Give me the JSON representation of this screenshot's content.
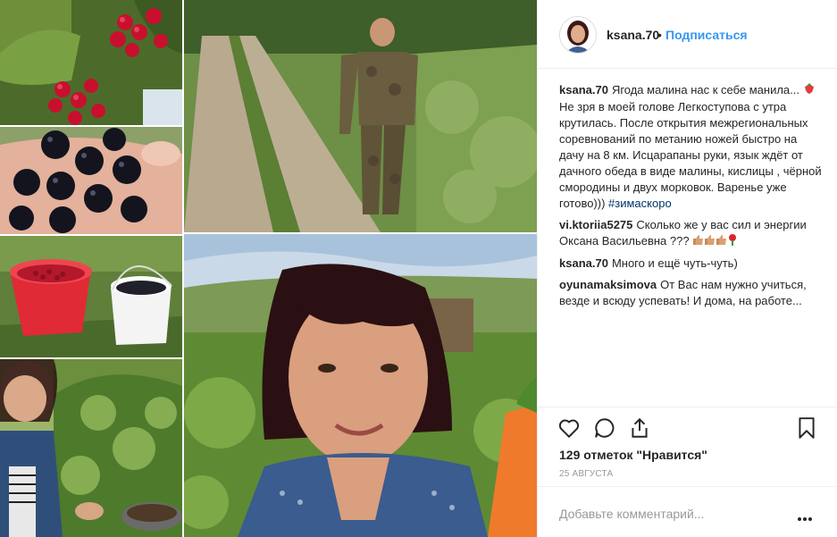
{
  "post": {
    "username": "ksana.70",
    "separator": "•",
    "follow_label": "Подписаться"
  },
  "comments": [
    {
      "user": "ksana.70",
      "text_1": "Ягода малина нас к себе манила...",
      "text_2": "Не зря в моей голове Легкоступова с утра крутилась. После открытия межрегиональных соревнований по метанию ножей быстро на дачу на 8 км. Исцарапаны руки, язык ждёт от дачного обеда в виде малины, кислицы , чёрной смородины и двух морковок. Варенье уже готово)))",
      "hashtag": "#зимаскоро"
    },
    {
      "user": "vi.ktoriia5275",
      "text": "Сколько же у вас сил и энергии Оксана Васильевна ???"
    },
    {
      "user": "ksana.70",
      "text": "Много и ещё чуть-чуть)"
    },
    {
      "user": "oyunamaksimova",
      "text": "От Вас нам нужно учиться, везде и всюду успевать! И дома, на работе..."
    }
  ],
  "likes_text": "129 отметок \"Нравится\"",
  "date_text": "25 АВГУСТА",
  "add_comment_placeholder": "Добавьте комментарий...",
  "icons": {
    "like": "heart-icon",
    "comment": "comment-icon",
    "share": "share-icon",
    "save": "bookmark-icon",
    "more": "more-dots-icon"
  },
  "colors": {
    "accent": "#3897f0",
    "hashtag": "#003569",
    "text": "#262626",
    "muted": "#999999",
    "border": "#efefef"
  }
}
